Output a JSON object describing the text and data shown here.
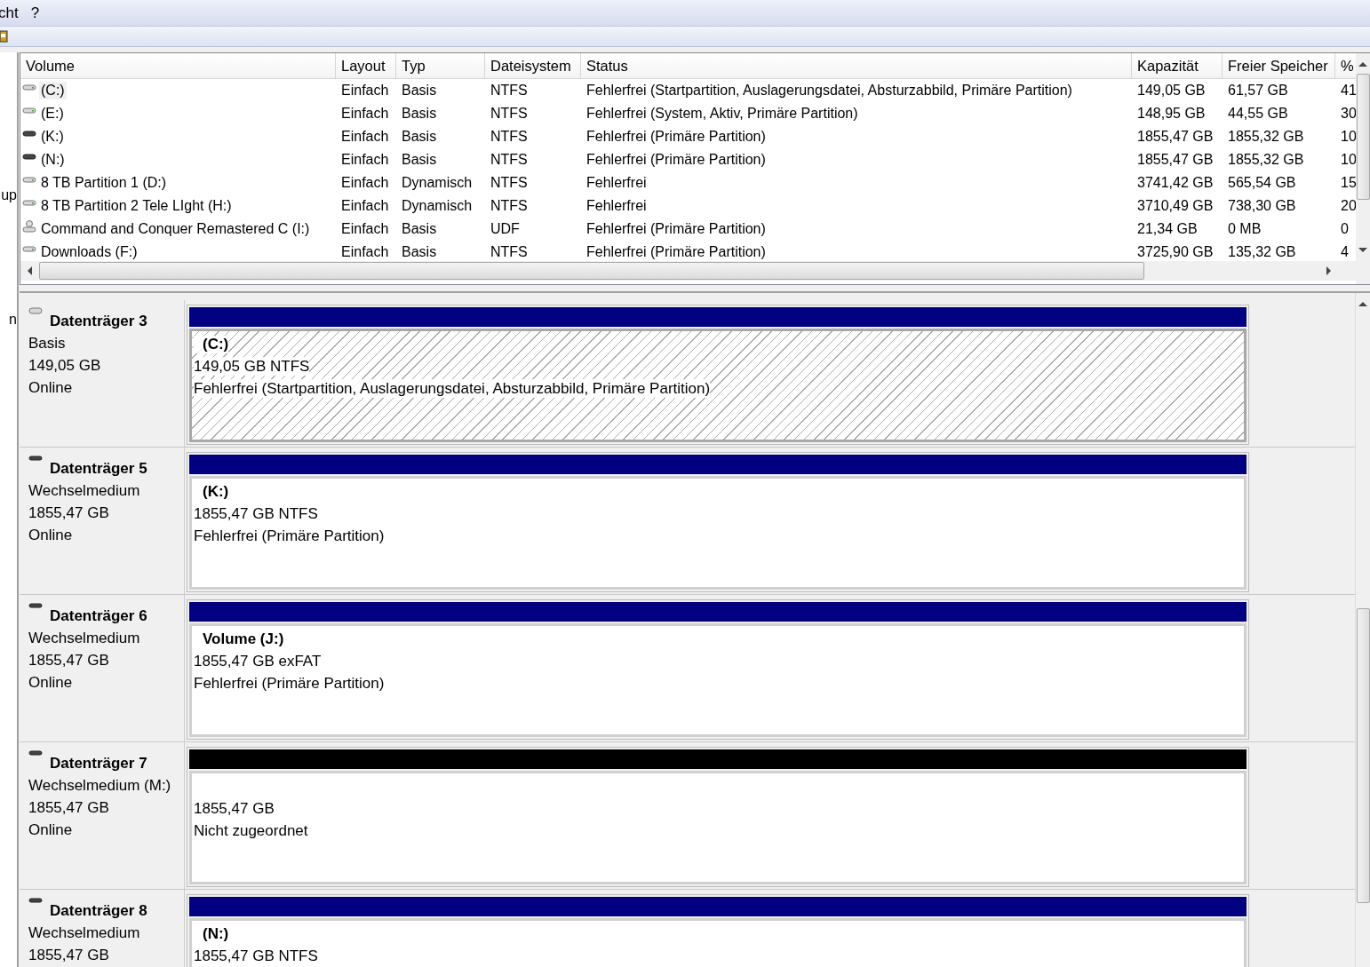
{
  "menu": [
    "cht",
    "?"
  ],
  "left_pane": [
    "up",
    "n"
  ],
  "table": {
    "columns": [
      "Volume",
      "Layout",
      "Typ",
      "Dateisystem",
      "Status",
      "Kapazität",
      "Freier Speicher",
      "%"
    ],
    "rows": [
      {
        "kind": "fixed",
        "selected": true,
        "cells": [
          "(C:)",
          "Einfach",
          "Basis",
          "NTFS",
          "Fehlerfrei (Startpartition, Auslagerungsdatei, Absturzabbild, Primäre Partition)",
          "149,05 GB",
          "61,57 GB",
          "41"
        ]
      },
      {
        "kind": "fixed",
        "selected": false,
        "cells": [
          "(E:)",
          "Einfach",
          "Basis",
          "NTFS",
          "Fehlerfrei (System, Aktiv, Primäre Partition)",
          "148,95 GB",
          "44,55 GB",
          "30"
        ]
      },
      {
        "kind": "removable",
        "selected": false,
        "cells": [
          "(K:)",
          "Einfach",
          "Basis",
          "NTFS",
          "Fehlerfrei (Primäre Partition)",
          "1855,47 GB",
          "1855,32 GB",
          "10"
        ]
      },
      {
        "kind": "removable",
        "selected": false,
        "cells": [
          "(N:)",
          "Einfach",
          "Basis",
          "NTFS",
          "Fehlerfrei (Primäre Partition)",
          "1855,47 GB",
          "1855,32 GB",
          "10"
        ]
      },
      {
        "kind": "fixed",
        "selected": false,
        "cells": [
          "8 TB Partition 1 (D:)",
          "Einfach",
          "Dynamisch",
          "NTFS",
          "Fehlerfrei",
          "3741,42 GB",
          "565,54 GB",
          "15"
        ]
      },
      {
        "kind": "fixed",
        "selected": false,
        "cells": [
          "8 TB Partition 2 Tele LIght (H:)",
          "Einfach",
          "Dynamisch",
          "NTFS",
          "Fehlerfrei",
          "3710,49 GB",
          "738,30 GB",
          "20"
        ]
      },
      {
        "kind": "optical",
        "selected": false,
        "cells": [
          "Command and Conquer Remastered C (I:)",
          "Einfach",
          "Basis",
          "UDF",
          "Fehlerfrei (Primäre Partition)",
          "21,34 GB",
          "0 MB",
          "0"
        ]
      },
      {
        "kind": "fixed",
        "selected": false,
        "cells": [
          "Downloads (F:)",
          "Einfach",
          "Basis",
          "NTFS",
          "Fehlerfrei (Primäre Partition)",
          "3725,90 GB",
          "135,32 GB",
          "4"
        ]
      }
    ]
  },
  "disks": [
    {
      "kind": "fixed",
      "name": "Datenträger 3",
      "type": "Basis",
      "size": "149,05 GB",
      "status": "Online",
      "partition": {
        "kind": "primary",
        "selected": true,
        "title": "(C:)",
        "size": "149,05 GB NTFS",
        "status": "Fehlerfrei (Startpartition, Auslagerungsdatei, Absturzabbild, Primäre Partition)"
      }
    },
    {
      "kind": "removable",
      "name": "Datenträger 5",
      "type": "Wechselmedium",
      "size": "1855,47 GB",
      "status": "Online",
      "partition": {
        "kind": "primary",
        "selected": false,
        "title": "(K:)",
        "size": "1855,47 GB NTFS",
        "status": "Fehlerfrei (Primäre Partition)"
      }
    },
    {
      "kind": "removable",
      "name": "Datenträger 6",
      "type": "Wechselmedium",
      "size": "1855,47 GB",
      "status": "Online",
      "partition": {
        "kind": "primary",
        "selected": false,
        "title": "Volume  (J:)",
        "size": "1855,47 GB exFAT",
        "status": "Fehlerfrei (Primäre Partition)"
      }
    },
    {
      "kind": "removable",
      "name": "Datenträger 7",
      "type": "Wechselmedium (M:)",
      "size": "1855,47 GB",
      "status": "Online",
      "partition": {
        "kind": "unallocated",
        "selected": false,
        "size": "1855,47 GB",
        "status": "Nicht zugeordnet"
      }
    },
    {
      "kind": "removable",
      "name": "Datenträger 8",
      "type": "Wechselmedium",
      "size": "1855,47 GB",
      "partition": {
        "kind": "primary",
        "selected": false,
        "title": "(N:)",
        "size": "1855,47 GB NTFS"
      }
    }
  ]
}
